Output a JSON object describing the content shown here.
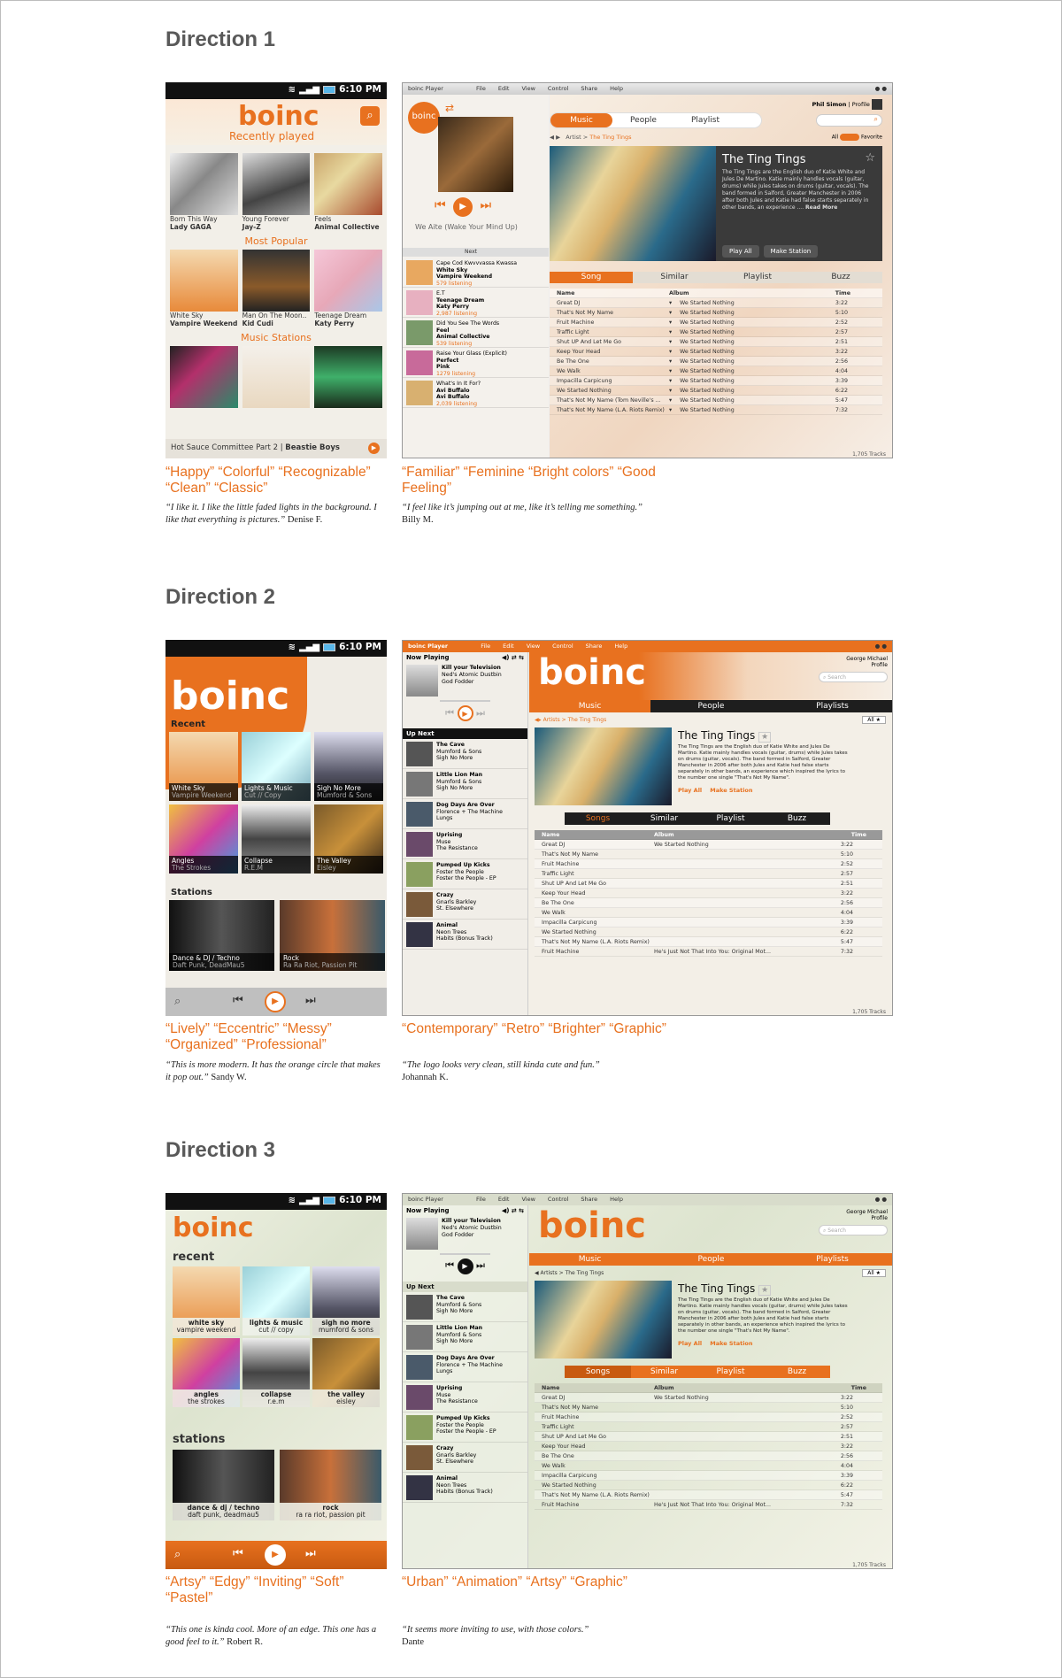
{
  "directions": [
    {
      "title": "Direction 1",
      "phone": {
        "time": "6:10 PM",
        "logo": "boinc",
        "recent_heading": "Recently played",
        "recent": [
          {
            "title": "Born This Way",
            "artist": "Lady GAGA"
          },
          {
            "title": "Young Forever",
            "artist": "Jay-Z"
          },
          {
            "title": "Feels",
            "artist": "Animal Collective"
          }
        ],
        "popular_heading": "Most Popular",
        "popular": [
          {
            "title": "White Sky",
            "artist": "Vampire Weekend"
          },
          {
            "title": "Man On The Moon..",
            "artist": "Kid Cudi"
          },
          {
            "title": "Teenage Dream",
            "artist": "Katy Perry"
          }
        ],
        "stations_heading": "Music Stations",
        "now_playing": "Hot Sauce Committee Part 2",
        "now_playing_artist": "Beastie Boys"
      },
      "desktop": {
        "app_title": "boinc Player",
        "menu": [
          "File",
          "Edit",
          "View",
          "Control",
          "Share",
          "Help"
        ],
        "user": "Phil Simon",
        "profile": "Profile",
        "tabs": [
          "Music",
          "People",
          "Playlist"
        ],
        "breadcrumb": [
          "Artist",
          "The Ting Tings"
        ],
        "filter_all": "All",
        "filter_fav": "Favorite",
        "current_track": "We Aite (Wake Your Mind Up)",
        "next_label": "Next",
        "queue": [
          {
            "title": "Cape Cod Kwvvvassa Kwassa",
            "line2": "White Sky",
            "line3": "Vampire Weekend",
            "count": "579 listening"
          },
          {
            "title": "E.T",
            "line2": "Teenage Dream",
            "line3": "Katy Perry",
            "count": "2,987 listening"
          },
          {
            "title": "Did You See The Words",
            "line2": "Feel",
            "line3": "Animal Collective",
            "count": "539 listening"
          },
          {
            "title": "Raise Your Glass (Explicit)",
            "line2": "Perfect",
            "line3": "Pink",
            "count": "1279 listening"
          },
          {
            "title": "What's In It For?",
            "line2": "Avi Buffalo",
            "line3": "Avi Buffalo",
            "count": "2,039 listening"
          }
        ],
        "artist": "The Ting Tings",
        "bio": "The Ting Tings are the English duo of Katie White and Jules De Martino. Katie mainly handles vocals (guitar, drums) while Jules takes on drums (guitar, vocals). The band formed in Salford, Greater Manchester in 2006 after both Jules and Katie had false starts separately in other bands, an experience ....",
        "read_more": "Read More",
        "play_all": "Play All",
        "make_station": "Make Station",
        "subtabs": [
          "Song",
          "Similar",
          "Playlist",
          "Buzz"
        ],
        "columns": [
          "Name",
          "Album",
          "Time"
        ],
        "tracks": [
          {
            "name": "Great DJ",
            "album": "We Started Nothing",
            "time": "3:22"
          },
          {
            "name": "That's Not My Name",
            "album": "We Started Nothing",
            "time": "5:10"
          },
          {
            "name": "Fruit Machine",
            "album": "We Started Nothing",
            "time": "2:52"
          },
          {
            "name": "Traffic Light",
            "album": "We Started Nothing",
            "time": "2:57"
          },
          {
            "name": "Shut UP And Let Me Go",
            "album": "We Started Nothing",
            "time": "2:51"
          },
          {
            "name": "Keep Your Head",
            "album": "We Started Nothing",
            "time": "3:22"
          },
          {
            "name": "Be The One",
            "album": "We Started Nothing",
            "time": "2:56"
          },
          {
            "name": "We Walk",
            "album": "We Started Nothing",
            "time": "4:04"
          },
          {
            "name": "Impacilla Carpicung",
            "album": "We Started Nothing",
            "time": "3:39"
          },
          {
            "name": "We Started Nothing",
            "album": "We Started Nothing",
            "time": "6:22"
          },
          {
            "name": "That's Not My Name (Tom Neville's ...",
            "album": "We Started Nothing",
            "time": "5:47"
          },
          {
            "name": "That's Not My Name (L.A. Riots Remix)",
            "album": "We Started Nothing",
            "time": "7:32"
          }
        ],
        "track_count": "1,705 Tracks"
      },
      "words": "“Happy” “Colorful” “Recognizable” “Clean” “Classic”",
      "quote": "“I like it. I like the little faded lights in the background. I like that everything is pictures.”",
      "quote_author": "Denise F.",
      "desk_words": "“Familiar” “Feminine “Bright colors” “Good Feeling”",
      "desk_quote": "“I feel like it’s jumping out at me, like it’s telling me something.”",
      "desk_quote_author": "Billy M."
    },
    {
      "title": "Direction 2",
      "phone": {
        "time": "6:10 PM",
        "logo": "boinc",
        "recent_heading": "Recent",
        "recent": [
          {
            "title": "White Sky",
            "artist": "Vampire Weekend"
          },
          {
            "title": "Lights & Music",
            "artist": "Cut // Copy"
          },
          {
            "title": "Sigh No More",
            "artist": "Mumford & Sons"
          },
          {
            "title": "Angles",
            "artist": "The Strokes"
          },
          {
            "title": "Collapse",
            "artist": "R.E.M"
          },
          {
            "title": "The Valley",
            "artist": "Eisley"
          }
        ],
        "stations_heading": "Stations",
        "stations": [
          {
            "title": "Dance & DJ / Techno",
            "artist": "Daft Punk, DeadMau5"
          },
          {
            "title": "Rock",
            "artist": "Ra Ra Riot, Passion Pit"
          }
        ]
      },
      "desktop": {
        "app_title": "boinc Player",
        "menu": [
          "File",
          "Edit",
          "View",
          "Control",
          "Share",
          "Help"
        ],
        "now_playing_label": "Now Playing",
        "now_title": "Kill your Television",
        "now_artist": "Ned's Atomic Dustbin",
        "now_album": "God Fodder",
        "up_next_label": "Up Next",
        "queue": [
          {
            "title": "The Cave",
            "line2": "Mumford & Sons",
            "line3": "Sigh No More"
          },
          {
            "title": "Little Lion Man",
            "line2": "Mumford & Sons",
            "line3": "Sigh No More"
          },
          {
            "title": "Dog Days Are Over",
            "line2": "Florence + The Machine",
            "line3": "Lungs"
          },
          {
            "title": "Uprising",
            "line2": "Muse",
            "line3": "The Resistance"
          },
          {
            "title": "Pumped Up Kicks",
            "line2": "Foster the People",
            "line3": "Foster the People - EP"
          },
          {
            "title": "Crazy",
            "line2": "Gnarls Barkley",
            "line3": "St. Elsewhere"
          },
          {
            "title": "Animal",
            "line2": "Neon Trees",
            "line3": "Habits (Bonus Track)"
          }
        ],
        "logo": "boinc",
        "user": "George Michael",
        "profile": "Profile",
        "search": "Search",
        "tabs": [
          "Music",
          "People",
          "Playlists"
        ],
        "breadcrumb": "Artists > The Ting Tings",
        "filter_all": "All",
        "artist": "The Ting Tings",
        "bio": "The Ting Tings are the English duo of Katie White and Jules De Martino. Katie mainly handles vocals (guitar, drums) while Jules takes on drums (guitar, vocals). The band formed in Salford, Greater Manchester in 2006 after both Jules and Katie had false starts separately in other bands, an experience which inspired the lyrics to the number one single \"That's Not My Name\".",
        "play_all": "Play All",
        "make_station": "Make Station",
        "subtabs": [
          "Songs",
          "Similar",
          "Playlist",
          "Buzz"
        ],
        "columns": [
          "Name",
          "Album",
          "Time"
        ],
        "tracks": [
          {
            "name": "Great DJ",
            "album": "We Started Nothing",
            "time": "3:22"
          },
          {
            "name": "That's Not My Name",
            "album": "",
            "time": "5:10"
          },
          {
            "name": "Fruit Machine",
            "album": "",
            "time": "2:52"
          },
          {
            "name": "Traffic Light",
            "album": "",
            "time": "2:57"
          },
          {
            "name": "Shut UP And Let Me Go",
            "album": "",
            "time": "2:51"
          },
          {
            "name": "Keep Your Head",
            "album": "",
            "time": "3:22"
          },
          {
            "name": "Be The One",
            "album": "",
            "time": "2:56"
          },
          {
            "name": "We Walk",
            "album": "",
            "time": "4:04"
          },
          {
            "name": "Impacilla Carpicung",
            "album": "",
            "time": "3:39"
          },
          {
            "name": "We Started Nothing",
            "album": "",
            "time": "6:22"
          },
          {
            "name": "That's Not My Name (L.A. Riots Remix)",
            "album": "",
            "time": "5:47"
          },
          {
            "name": "Fruit Machine",
            "album": "He's Just Not That Into You: Original Mot...",
            "time": "7:32"
          }
        ],
        "track_count": "1,705 Tracks"
      },
      "words": "“Lively” “Eccentric” “Messy” “Organized” “Professional”",
      "quote": "“This is more modern. It has the orange circle that makes it pop out.”",
      "quote_author": "Sandy W.",
      "desk_words": "“Contemporary” “Retro” “Brighter” “Graphic”",
      "desk_quote": "“The logo looks very clean, still kinda cute and fun.”",
      "desk_quote_author": "Johannah K."
    },
    {
      "title": "Direction 3",
      "phone": {
        "time": "6:10 PM",
        "logo": "boinc",
        "recent_heading": "recent",
        "recent": [
          {
            "title": "white sky",
            "artist": "vampire weekend"
          },
          {
            "title": "lights & music",
            "artist": "cut // copy"
          },
          {
            "title": "sigh no more",
            "artist": "mumford & sons"
          },
          {
            "title": "angles",
            "artist": "the strokes"
          },
          {
            "title": "collapse",
            "artist": "r.e.m"
          },
          {
            "title": "the valley",
            "artist": "eisley"
          }
        ],
        "stations_heading": "stations",
        "stations": [
          {
            "title": "dance & dj / techno",
            "artist": "daft punk, deadmau5"
          },
          {
            "title": "rock",
            "artist": "ra ra riot, passion pit"
          }
        ]
      },
      "desktop": {
        "app_title": "boinc Player",
        "menu": [
          "File",
          "Edit",
          "View",
          "Control",
          "Share",
          "Help"
        ],
        "now_playing_label": "Now Playing",
        "now_title": "Kill your Television",
        "now_artist": "Ned's Atomic Dustbin",
        "now_album": "God Fodder",
        "up_next_label": "Up Next",
        "queue": [
          {
            "title": "The Cave",
            "line2": "Mumford & Sons",
            "line3": "Sigh No More"
          },
          {
            "title": "Little Lion Man",
            "line2": "Mumford & Sons",
            "line3": "Sigh No More"
          },
          {
            "title": "Dog Days Are Over",
            "line2": "Florence + The Machine",
            "line3": "Lungs"
          },
          {
            "title": "Uprising",
            "line2": "Muse",
            "line3": "The Resistance"
          },
          {
            "title": "Pumped Up Kicks",
            "line2": "Foster the People",
            "line3": "Foster the People - EP"
          },
          {
            "title": "Crazy",
            "line2": "Gnarls Barkley",
            "line3": "St. Elsewhere"
          },
          {
            "title": "Animal",
            "line2": "Neon Trees",
            "line3": "Habits (Bonus Track)"
          }
        ],
        "logo": "boinc",
        "user": "George Michael",
        "profile": "Profile",
        "search": "Search",
        "tabs": [
          "Music",
          "People",
          "Playlists"
        ],
        "breadcrumb": "Artists > The Ting Tings",
        "filter_all": "All",
        "artist": "The Ting Tings",
        "bio": "The Ting Tings are the English duo of Katie White and Jules De Martino. Katie mainly handles vocals (guitar, drums) while Jules takes on drums (guitar, vocals). The band formed in Salford, Greater Manchester in 2006 after both Jules and Katie had false starts separately in other bands, an experience which inspired the lyrics to the number one single \"That's Not My Name\".",
        "play_all": "Play All",
        "make_station": "Make Station",
        "subtabs": [
          "Songs",
          "Similar",
          "Playlist",
          "Buzz"
        ],
        "columns": [
          "Name",
          "Album",
          "Time"
        ],
        "tracks": [
          {
            "name": "Great DJ",
            "album": "We Started Nothing",
            "time": "3:22"
          },
          {
            "name": "That's Not My Name",
            "album": "",
            "time": "5:10"
          },
          {
            "name": "Fruit Machine",
            "album": "",
            "time": "2:52"
          },
          {
            "name": "Traffic Light",
            "album": "",
            "time": "2:57"
          },
          {
            "name": "Shut UP And Let Me Go",
            "album": "",
            "time": "2:51"
          },
          {
            "name": "Keep Your Head",
            "album": "",
            "time": "3:22"
          },
          {
            "name": "Be The One",
            "album": "",
            "time": "2:56"
          },
          {
            "name": "We Walk",
            "album": "",
            "time": "4:04"
          },
          {
            "name": "Impacilla Carpicung",
            "album": "",
            "time": "3:39"
          },
          {
            "name": "We Started Nothing",
            "album": "",
            "time": "6:22"
          },
          {
            "name": "That's Not My Name (L.A. Riots Remix)",
            "album": "",
            "time": "5:47"
          },
          {
            "name": "Fruit Machine",
            "album": "He's Just Not That Into You: Original Mot...",
            "time": "7:32"
          }
        ],
        "track_count": "1,705 Tracks"
      },
      "words": "“Artsy” “Edgy” “Inviting” “Soft” “Pastel”",
      "quote": "“This one is kinda cool. More of an edge. This one has a good feel to it.”",
      "quote_author": "Robert R.",
      "desk_words": "“Urban” “Animation” “Artsy” “Graphic”",
      "desk_quote": "“It seems more inviting to use, with those colors.”",
      "desk_quote_author": "Dante"
    }
  ],
  "colors": {
    "accent": "#e8711f",
    "dark": "#2b2b2b",
    "text": "#595959"
  }
}
